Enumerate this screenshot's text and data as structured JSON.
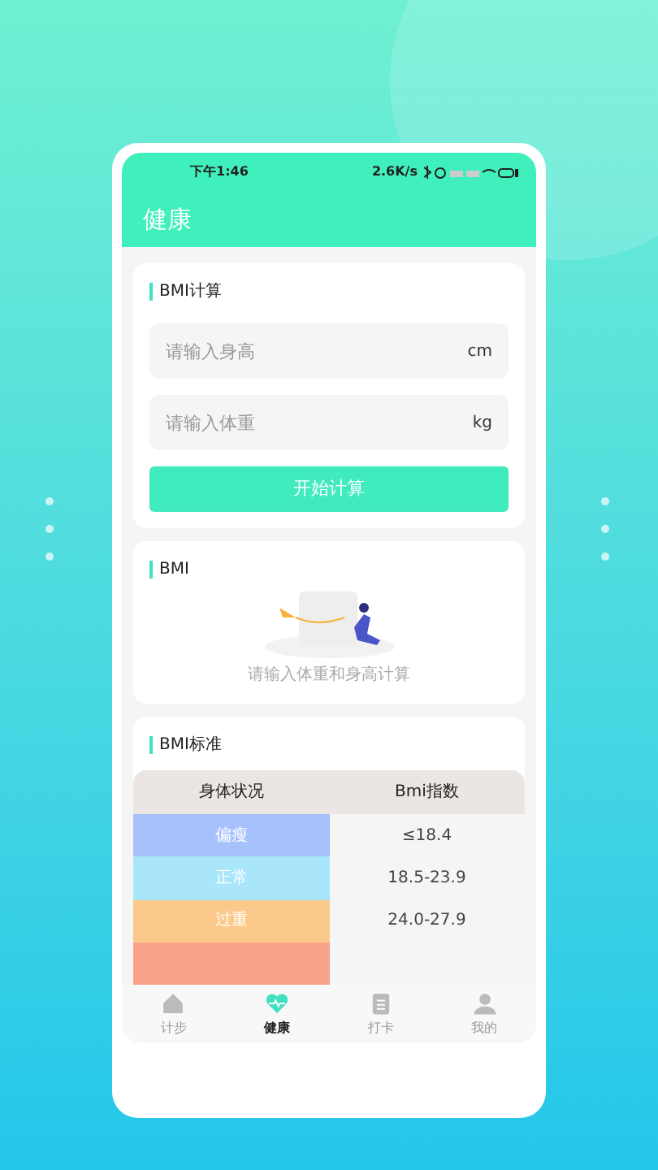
{
  "status_bar": {
    "time": "下午1:46",
    "speed": "2.6K/s"
  },
  "header": {
    "title": "健康"
  },
  "bmi_calc": {
    "title": "BMI计算",
    "fields": [
      {
        "placeholder": "请输入身高",
        "unit": "cm"
      },
      {
        "placeholder": "请输入体重",
        "unit": "kg"
      }
    ],
    "button": "开始计算"
  },
  "bmi_result": {
    "title": "BMI",
    "hint": "请输入体重和身高计算"
  },
  "bmi_standard": {
    "title": "BMI标准",
    "columns": [
      "身体状况",
      "Bmi指数"
    ],
    "rows": [
      {
        "status": "偏瘦",
        "range": "≤18.4",
        "color": "#a6c1fb"
      },
      {
        "status": "正常",
        "range": "18.5-23.9",
        "color": "#a9e6f9"
      },
      {
        "status": "过重",
        "range": "24.0-27.9",
        "color": "#fbc98a"
      },
      {
        "color": "#f9a48a"
      }
    ]
  },
  "tab_bar": [
    {
      "label": "计步",
      "kind": "home",
      "selected": false
    },
    {
      "label": "健康",
      "kind": "heart",
      "selected": true
    },
    {
      "label": "打卡",
      "kind": "note",
      "selected": false
    },
    {
      "label": "我的",
      "kind": "person",
      "selected": false
    }
  ]
}
